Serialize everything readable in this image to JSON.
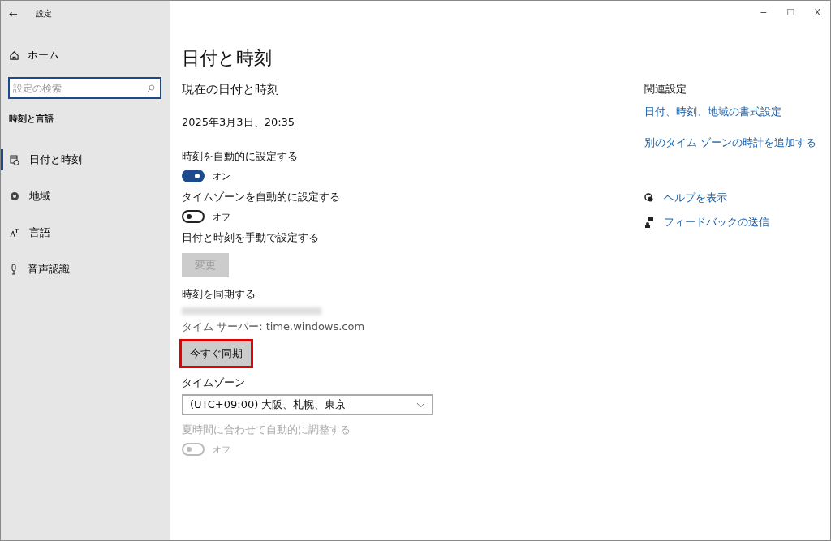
{
  "window": {
    "title": "設定",
    "back": "←",
    "controls": [
      "−",
      "☐",
      "X"
    ]
  },
  "sidebar": {
    "home": "ホーム",
    "search": {
      "placeholder": "設定の検索"
    },
    "section": "時刻と言語",
    "items": [
      {
        "label": "日付と時刻",
        "selected": true
      },
      {
        "label": "地域",
        "selected": false
      },
      {
        "label": "言語",
        "selected": false
      },
      {
        "label": "音声認識",
        "selected": false
      }
    ]
  },
  "main": {
    "title": "日付と時刻",
    "heading": "現在の日付と時刻",
    "datetime": "2025年3月3日、20:35",
    "settings": [
      {
        "kind": "toggle",
        "label": "時刻を自動的に設定する",
        "on": true,
        "state_text": "オン",
        "disabled": false
      },
      {
        "kind": "toggle",
        "label": "タイムゾーンを自動的に設定する",
        "on": false,
        "state_text": "オフ",
        "disabled": false
      },
      {
        "kind": "button",
        "label": "日付と時刻を手動で設定する",
        "button": "変更",
        "disabled": true
      },
      {
        "kind": "sync",
        "label": "時刻を同期する",
        "server": "タイム サーバー: time.windows.com",
        "button": "今すぐ同期",
        "disabled": false,
        "highlighted": true
      },
      {
        "kind": "select",
        "label": "タイムゾーン",
        "value": "(UTC+09:00) 大阪、札幌、東京"
      },
      {
        "kind": "toggle",
        "label": "夏時間に合わせて自動的に調整する",
        "on": false,
        "state_text": "オフ",
        "disabled": true
      }
    ]
  },
  "related": {
    "heading": "関連設定",
    "links": [
      "日付、時刻、地域の書式設定",
      "別のタイム ゾーンの時計を追加する"
    ],
    "help": [
      "ヘルプを表示",
      "フィードバックの送信"
    ]
  }
}
